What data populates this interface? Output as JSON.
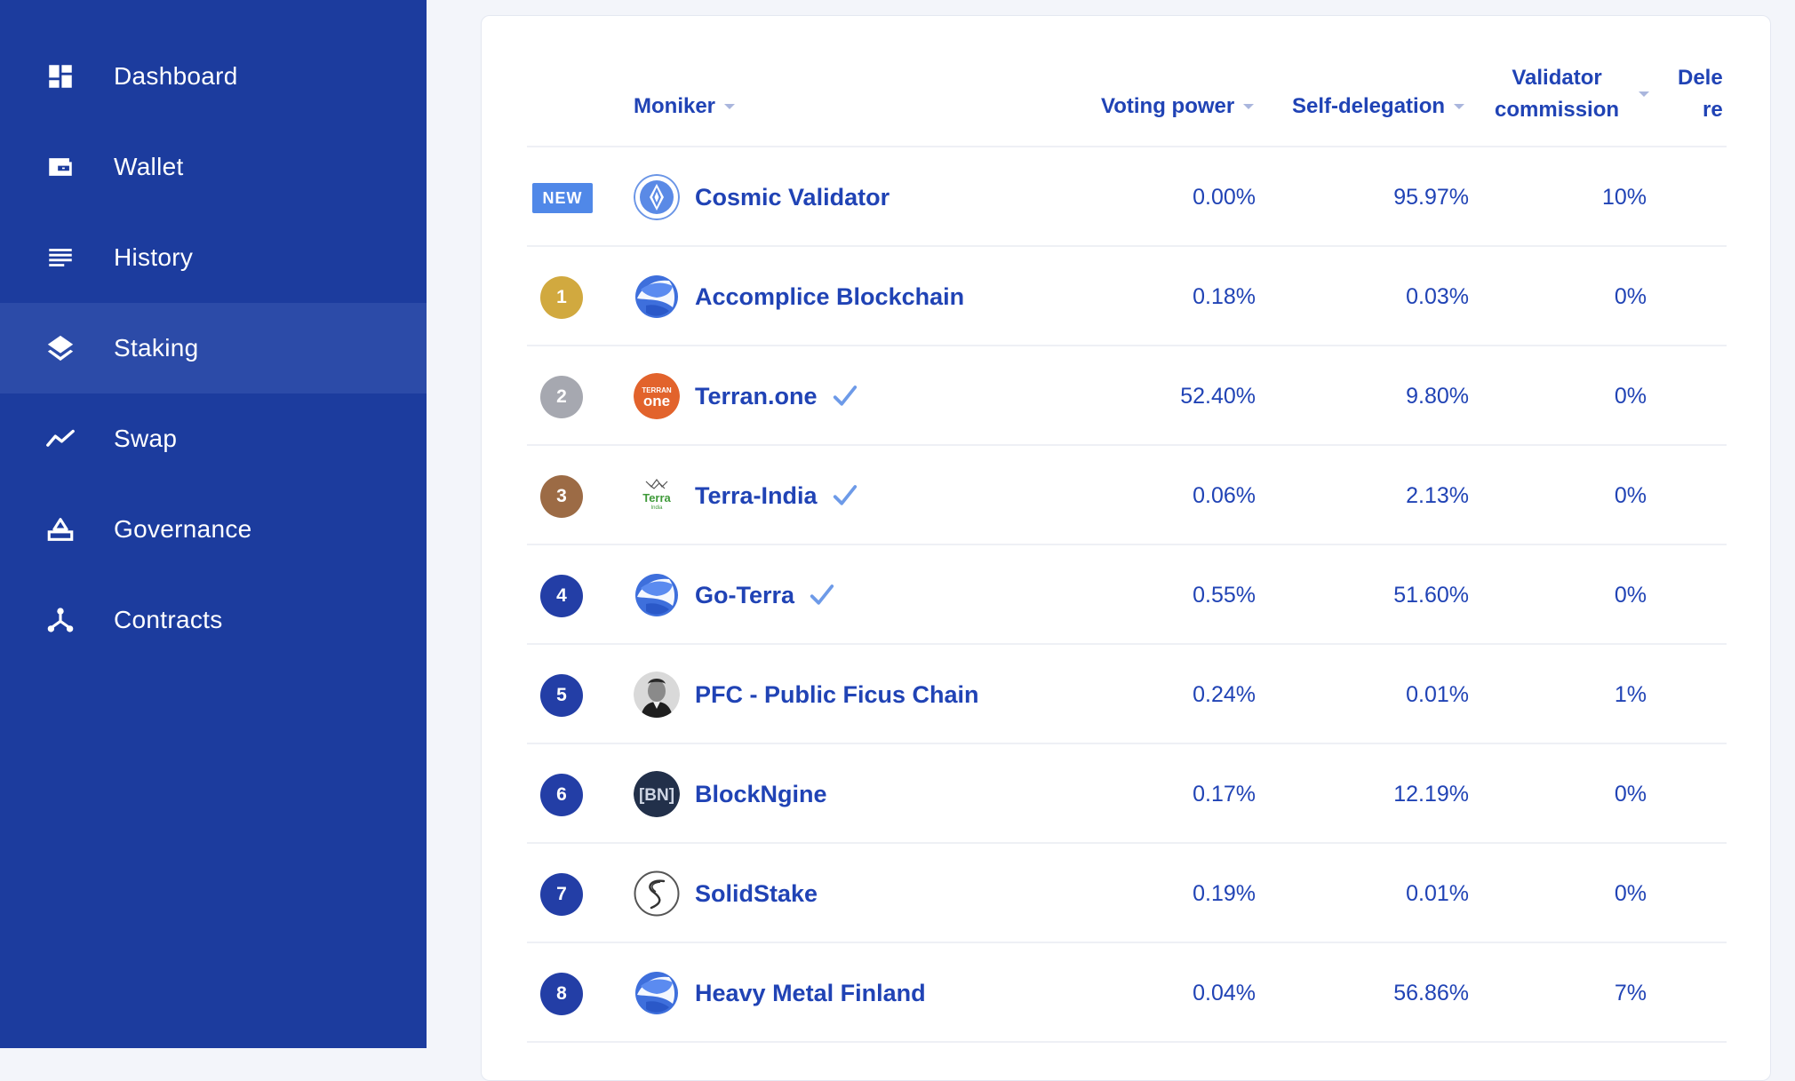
{
  "sidebar": {
    "items": [
      {
        "label": "Dashboard",
        "icon": "dashboard-icon",
        "active": false
      },
      {
        "label": "Wallet",
        "icon": "wallet-icon",
        "active": false
      },
      {
        "label": "History",
        "icon": "history-icon",
        "active": false
      },
      {
        "label": "Staking",
        "icon": "staking-icon",
        "active": true
      },
      {
        "label": "Swap",
        "icon": "swap-icon",
        "active": false
      },
      {
        "label": "Governance",
        "icon": "governance-icon",
        "active": false
      },
      {
        "label": "Contracts",
        "icon": "contracts-icon",
        "active": false
      }
    ]
  },
  "table": {
    "headers": {
      "moniker": "Moniker",
      "voting_power": "Voting power",
      "self_delegation": "Self-delegation",
      "validator_commission_1": "Validator",
      "validator_commission_2": "commission",
      "delegation_1": "Dele",
      "delegation_2": "re"
    },
    "rows": [
      {
        "rank": "NEW",
        "moniker": "Cosmic Validator",
        "verified": false,
        "voting_power": "0.00%",
        "self_delegation": "95.97%",
        "commission": "10%",
        "avatar": "cosmic-validator-avatar"
      },
      {
        "rank": "1",
        "moniker": "Accomplice Blockchain",
        "verified": false,
        "voting_power": "0.18%",
        "self_delegation": "0.03%",
        "commission": "0%",
        "avatar": "terra-planet-avatar"
      },
      {
        "rank": "2",
        "moniker": "Terran.one",
        "verified": true,
        "voting_power": "52.40%",
        "self_delegation": "9.80%",
        "commission": "0%",
        "avatar": "terran-one-avatar"
      },
      {
        "rank": "3",
        "moniker": "Terra-India",
        "verified": true,
        "voting_power": "0.06%",
        "self_delegation": "2.13%",
        "commission": "0%",
        "avatar": "terra-india-avatar"
      },
      {
        "rank": "4",
        "moniker": "Go-Terra",
        "verified": true,
        "voting_power": "0.55%",
        "self_delegation": "51.60%",
        "commission": "0%",
        "avatar": "terra-planet-avatar"
      },
      {
        "rank": "5",
        "moniker": "PFC - Public Ficus Chain",
        "verified": false,
        "voting_power": "0.24%",
        "self_delegation": "0.01%",
        "commission": "1%",
        "avatar": "pfc-portrait-avatar"
      },
      {
        "rank": "6",
        "moniker": "BlockNgine",
        "verified": false,
        "voting_power": "0.17%",
        "self_delegation": "12.19%",
        "commission": "0%",
        "avatar": "blockngine-avatar"
      },
      {
        "rank": "7",
        "moniker": "SolidStake",
        "verified": false,
        "voting_power": "0.19%",
        "self_delegation": "0.01%",
        "commission": "0%",
        "avatar": "solidstake-avatar"
      },
      {
        "rank": "8",
        "moniker": "Heavy Metal Finland",
        "verified": false,
        "voting_power": "0.04%",
        "self_delegation": "56.86%",
        "commission": "7%",
        "avatar": "terra-planet-avatar"
      }
    ],
    "terran_logo_text_1": "TERRAN",
    "terran_logo_text_2": "one",
    "terra_india_logo_text_1": "Terra",
    "terra_india_logo_text_2": "India",
    "blockngine_logo_text": "[BN]"
  },
  "colors": {
    "sidebar_bg": "#1c3c9e",
    "sidebar_active": "#2c4ba8",
    "text_primary": "#2043b5",
    "badge_gold": "#d1a93f",
    "badge_silver": "#a6a8b0",
    "badge_bronze": "#9c6b45",
    "badge_default": "#233ea6",
    "badge_new": "#5088e8",
    "verified_check": "#6d9ae8"
  }
}
